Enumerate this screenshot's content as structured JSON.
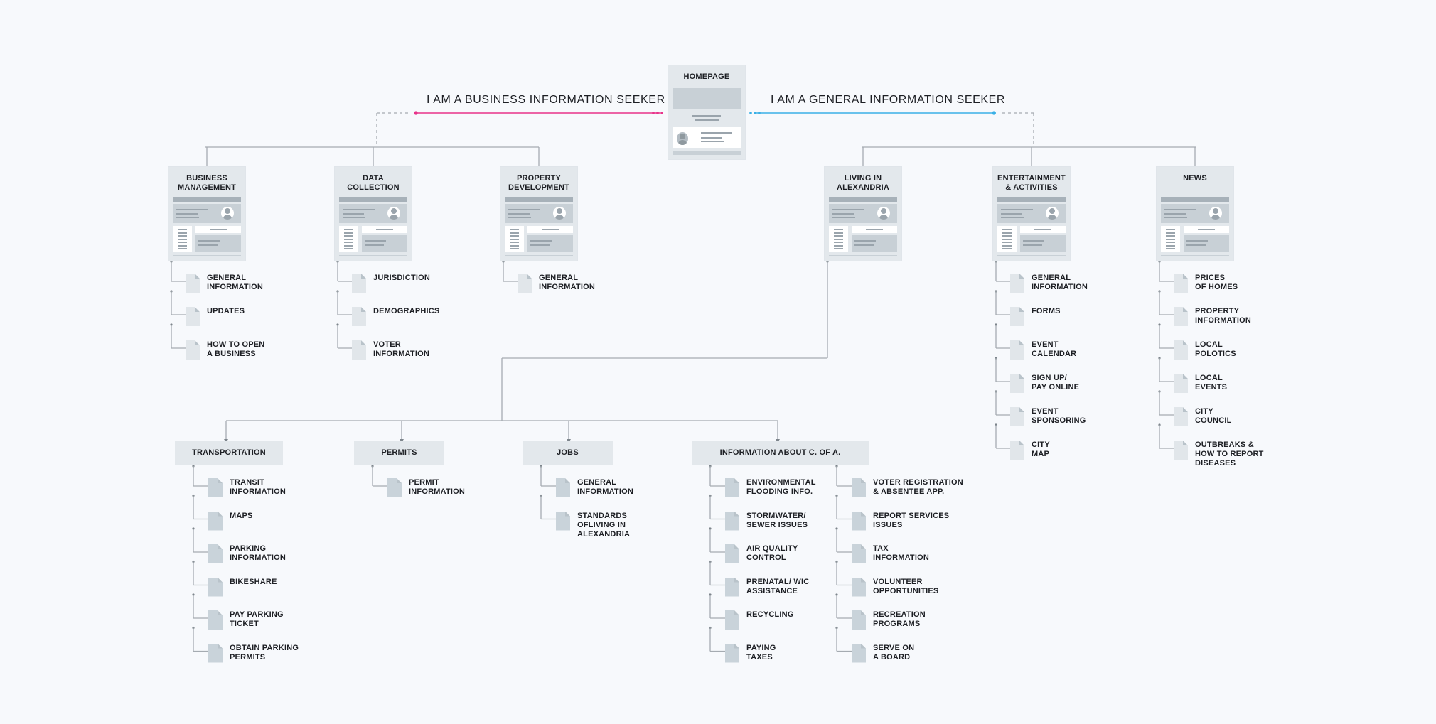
{
  "colors": {
    "background": "#f7f9fc",
    "business_path": "#e8338a",
    "general_path": "#3ab0e6",
    "connector": "#a5abb1",
    "card_fill": "#e3e8ec"
  },
  "homepage": {
    "label": "HOMEPAGE"
  },
  "personas": {
    "business": {
      "label": "I AM A BUSINESS INFORMATION SEEKER"
    },
    "general": {
      "label": "I AM A GENERAL INFORMATION SEEKER"
    }
  },
  "sections": [
    {
      "id": "business-management",
      "persona": "business",
      "label_lines": [
        "BUSINESS",
        "MANAGEMENT"
      ],
      "children": [
        {
          "lines": [
            "GENERAL",
            "INFORMATION"
          ]
        },
        {
          "lines": [
            "UPDATES"
          ]
        },
        {
          "lines": [
            "HOW TO OPEN",
            "A BUSINESS"
          ]
        }
      ]
    },
    {
      "id": "data-collection",
      "persona": "business",
      "label_lines": [
        "DATA",
        "COLLECTION"
      ],
      "children": [
        {
          "lines": [
            "JURISDICTION"
          ]
        },
        {
          "lines": [
            "DEMOGRAPHICS"
          ]
        },
        {
          "lines": [
            "VOTER",
            "INFORMATION"
          ]
        }
      ]
    },
    {
      "id": "property-development",
      "persona": "business",
      "label_lines": [
        "PROPERTY",
        "DEVELOPMENT"
      ],
      "children": [
        {
          "lines": [
            "GENERAL",
            "INFORMATION"
          ]
        }
      ]
    },
    {
      "id": "living-in-alexandria",
      "persona": "general",
      "label_lines": [
        "LIVING IN",
        "ALEXANDRIA"
      ],
      "children": []
    },
    {
      "id": "entertainment-activities",
      "persona": "general",
      "label_lines": [
        "ENTERTAINMENT",
        "& ACTIVITIES"
      ],
      "children": [
        {
          "lines": [
            "GENERAL",
            "INFORMATION"
          ]
        },
        {
          "lines": [
            "FORMS"
          ]
        },
        {
          "lines": [
            "EVENT",
            "CALENDAR"
          ]
        },
        {
          "lines": [
            "SIGN UP/",
            "PAY ONLINE"
          ]
        },
        {
          "lines": [
            "EVENT",
            "SPONSORING"
          ]
        },
        {
          "lines": [
            "CITY",
            "MAP"
          ]
        }
      ]
    },
    {
      "id": "news",
      "persona": "general",
      "label_lines": [
        "NEWS"
      ],
      "children": [
        {
          "lines": [
            "PRICES",
            "OF HOMES"
          ]
        },
        {
          "lines": [
            "PROPERTY",
            "INFORMATION"
          ]
        },
        {
          "lines": [
            "LOCAL",
            "POLOTICS"
          ]
        },
        {
          "lines": [
            "LOCAL",
            "EVENTS"
          ]
        },
        {
          "lines": [
            "CITY",
            "COUNCIL"
          ]
        },
        {
          "lines": [
            "OUTBREAKS &",
            "HOW TO REPORT",
            "DISEASES"
          ]
        }
      ]
    }
  ],
  "living_subsections": [
    {
      "id": "transportation",
      "label": "TRANSPORTATION",
      "columns": [
        [
          {
            "lines": [
              "TRANSIT",
              "INFORMATION"
            ]
          },
          {
            "lines": [
              "MAPS"
            ]
          },
          {
            "lines": [
              "PARKING",
              "INFORMATION"
            ]
          },
          {
            "lines": [
              "BIKESHARE"
            ]
          },
          {
            "lines": [
              "PAY PARKING",
              "TICKET"
            ]
          },
          {
            "lines": [
              "OBTAIN PARKING",
              "PERMITS"
            ]
          }
        ]
      ]
    },
    {
      "id": "permits",
      "label": "PERMITS",
      "columns": [
        [
          {
            "lines": [
              "PERMIT",
              "INFORMATION"
            ]
          }
        ]
      ]
    },
    {
      "id": "jobs",
      "label": "JOBS",
      "columns": [
        [
          {
            "lines": [
              "GENERAL",
              "INFORMATION"
            ]
          },
          {
            "lines": [
              "STANDARDS",
              "OFLIVING IN",
              "ALEXANDRIA"
            ]
          }
        ]
      ]
    },
    {
      "id": "information-about-c-of-a",
      "label": "INFORMATION ABOUT C. OF A.",
      "columns": [
        [
          {
            "lines": [
              "ENVIRONMENTAL",
              "FLOODING INFO."
            ]
          },
          {
            "lines": [
              "STORMWATER/",
              "SEWER ISSUES"
            ]
          },
          {
            "lines": [
              "AIR QUALITY",
              "CONTROL"
            ]
          },
          {
            "lines": [
              "PRENATAL/ WIC",
              "ASSISTANCE"
            ]
          },
          {
            "lines": [
              "RECYCLING"
            ]
          },
          {
            "lines": [
              "PAYING",
              "TAXES"
            ]
          }
        ],
        [
          {
            "lines": [
              "VOTER REGISTRATION",
              "& ABSENTEE APP."
            ]
          },
          {
            "lines": [
              "REPORT SERVICES",
              "ISSUES"
            ]
          },
          {
            "lines": [
              "TAX",
              "INFORMATION"
            ]
          },
          {
            "lines": [
              "VOLUNTEER",
              "OPPORTUNITIES"
            ]
          },
          {
            "lines": [
              "RECREATION",
              "PROGRAMS"
            ]
          },
          {
            "lines": [
              "SERVE ON",
              "A BOARD"
            ]
          }
        ]
      ]
    }
  ]
}
